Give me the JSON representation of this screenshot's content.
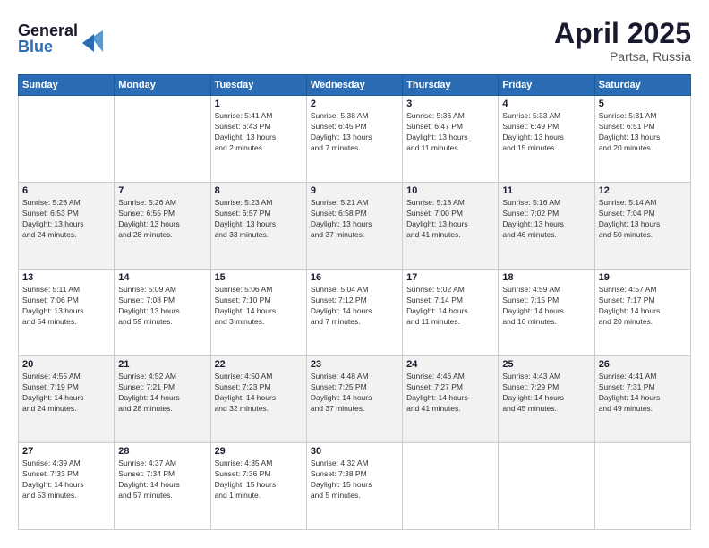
{
  "header": {
    "logo_line1": "General",
    "logo_line2": "Blue",
    "month": "April 2025",
    "location": "Partsa, Russia"
  },
  "days_of_week": [
    "Sunday",
    "Monday",
    "Tuesday",
    "Wednesday",
    "Thursday",
    "Friday",
    "Saturday"
  ],
  "weeks": [
    {
      "shade": false,
      "days": [
        {
          "num": "",
          "info": ""
        },
        {
          "num": "",
          "info": ""
        },
        {
          "num": "1",
          "info": "Sunrise: 5:41 AM\nSunset: 6:43 PM\nDaylight: 13 hours\nand 2 minutes."
        },
        {
          "num": "2",
          "info": "Sunrise: 5:38 AM\nSunset: 6:45 PM\nDaylight: 13 hours\nand 7 minutes."
        },
        {
          "num": "3",
          "info": "Sunrise: 5:36 AM\nSunset: 6:47 PM\nDaylight: 13 hours\nand 11 minutes."
        },
        {
          "num": "4",
          "info": "Sunrise: 5:33 AM\nSunset: 6:49 PM\nDaylight: 13 hours\nand 15 minutes."
        },
        {
          "num": "5",
          "info": "Sunrise: 5:31 AM\nSunset: 6:51 PM\nDaylight: 13 hours\nand 20 minutes."
        }
      ]
    },
    {
      "shade": true,
      "days": [
        {
          "num": "6",
          "info": "Sunrise: 5:28 AM\nSunset: 6:53 PM\nDaylight: 13 hours\nand 24 minutes."
        },
        {
          "num": "7",
          "info": "Sunrise: 5:26 AM\nSunset: 6:55 PM\nDaylight: 13 hours\nand 28 minutes."
        },
        {
          "num": "8",
          "info": "Sunrise: 5:23 AM\nSunset: 6:57 PM\nDaylight: 13 hours\nand 33 minutes."
        },
        {
          "num": "9",
          "info": "Sunrise: 5:21 AM\nSunset: 6:58 PM\nDaylight: 13 hours\nand 37 minutes."
        },
        {
          "num": "10",
          "info": "Sunrise: 5:18 AM\nSunset: 7:00 PM\nDaylight: 13 hours\nand 41 minutes."
        },
        {
          "num": "11",
          "info": "Sunrise: 5:16 AM\nSunset: 7:02 PM\nDaylight: 13 hours\nand 46 minutes."
        },
        {
          "num": "12",
          "info": "Sunrise: 5:14 AM\nSunset: 7:04 PM\nDaylight: 13 hours\nand 50 minutes."
        }
      ]
    },
    {
      "shade": false,
      "days": [
        {
          "num": "13",
          "info": "Sunrise: 5:11 AM\nSunset: 7:06 PM\nDaylight: 13 hours\nand 54 minutes."
        },
        {
          "num": "14",
          "info": "Sunrise: 5:09 AM\nSunset: 7:08 PM\nDaylight: 13 hours\nand 59 minutes."
        },
        {
          "num": "15",
          "info": "Sunrise: 5:06 AM\nSunset: 7:10 PM\nDaylight: 14 hours\nand 3 minutes."
        },
        {
          "num": "16",
          "info": "Sunrise: 5:04 AM\nSunset: 7:12 PM\nDaylight: 14 hours\nand 7 minutes."
        },
        {
          "num": "17",
          "info": "Sunrise: 5:02 AM\nSunset: 7:14 PM\nDaylight: 14 hours\nand 11 minutes."
        },
        {
          "num": "18",
          "info": "Sunrise: 4:59 AM\nSunset: 7:15 PM\nDaylight: 14 hours\nand 16 minutes."
        },
        {
          "num": "19",
          "info": "Sunrise: 4:57 AM\nSunset: 7:17 PM\nDaylight: 14 hours\nand 20 minutes."
        }
      ]
    },
    {
      "shade": true,
      "days": [
        {
          "num": "20",
          "info": "Sunrise: 4:55 AM\nSunset: 7:19 PM\nDaylight: 14 hours\nand 24 minutes."
        },
        {
          "num": "21",
          "info": "Sunrise: 4:52 AM\nSunset: 7:21 PM\nDaylight: 14 hours\nand 28 minutes."
        },
        {
          "num": "22",
          "info": "Sunrise: 4:50 AM\nSunset: 7:23 PM\nDaylight: 14 hours\nand 32 minutes."
        },
        {
          "num": "23",
          "info": "Sunrise: 4:48 AM\nSunset: 7:25 PM\nDaylight: 14 hours\nand 37 minutes."
        },
        {
          "num": "24",
          "info": "Sunrise: 4:46 AM\nSunset: 7:27 PM\nDaylight: 14 hours\nand 41 minutes."
        },
        {
          "num": "25",
          "info": "Sunrise: 4:43 AM\nSunset: 7:29 PM\nDaylight: 14 hours\nand 45 minutes."
        },
        {
          "num": "26",
          "info": "Sunrise: 4:41 AM\nSunset: 7:31 PM\nDaylight: 14 hours\nand 49 minutes."
        }
      ]
    },
    {
      "shade": false,
      "days": [
        {
          "num": "27",
          "info": "Sunrise: 4:39 AM\nSunset: 7:33 PM\nDaylight: 14 hours\nand 53 minutes."
        },
        {
          "num": "28",
          "info": "Sunrise: 4:37 AM\nSunset: 7:34 PM\nDaylight: 14 hours\nand 57 minutes."
        },
        {
          "num": "29",
          "info": "Sunrise: 4:35 AM\nSunset: 7:36 PM\nDaylight: 15 hours\nand 1 minute."
        },
        {
          "num": "30",
          "info": "Sunrise: 4:32 AM\nSunset: 7:38 PM\nDaylight: 15 hours\nand 5 minutes."
        },
        {
          "num": "",
          "info": ""
        },
        {
          "num": "",
          "info": ""
        },
        {
          "num": "",
          "info": ""
        }
      ]
    }
  ]
}
